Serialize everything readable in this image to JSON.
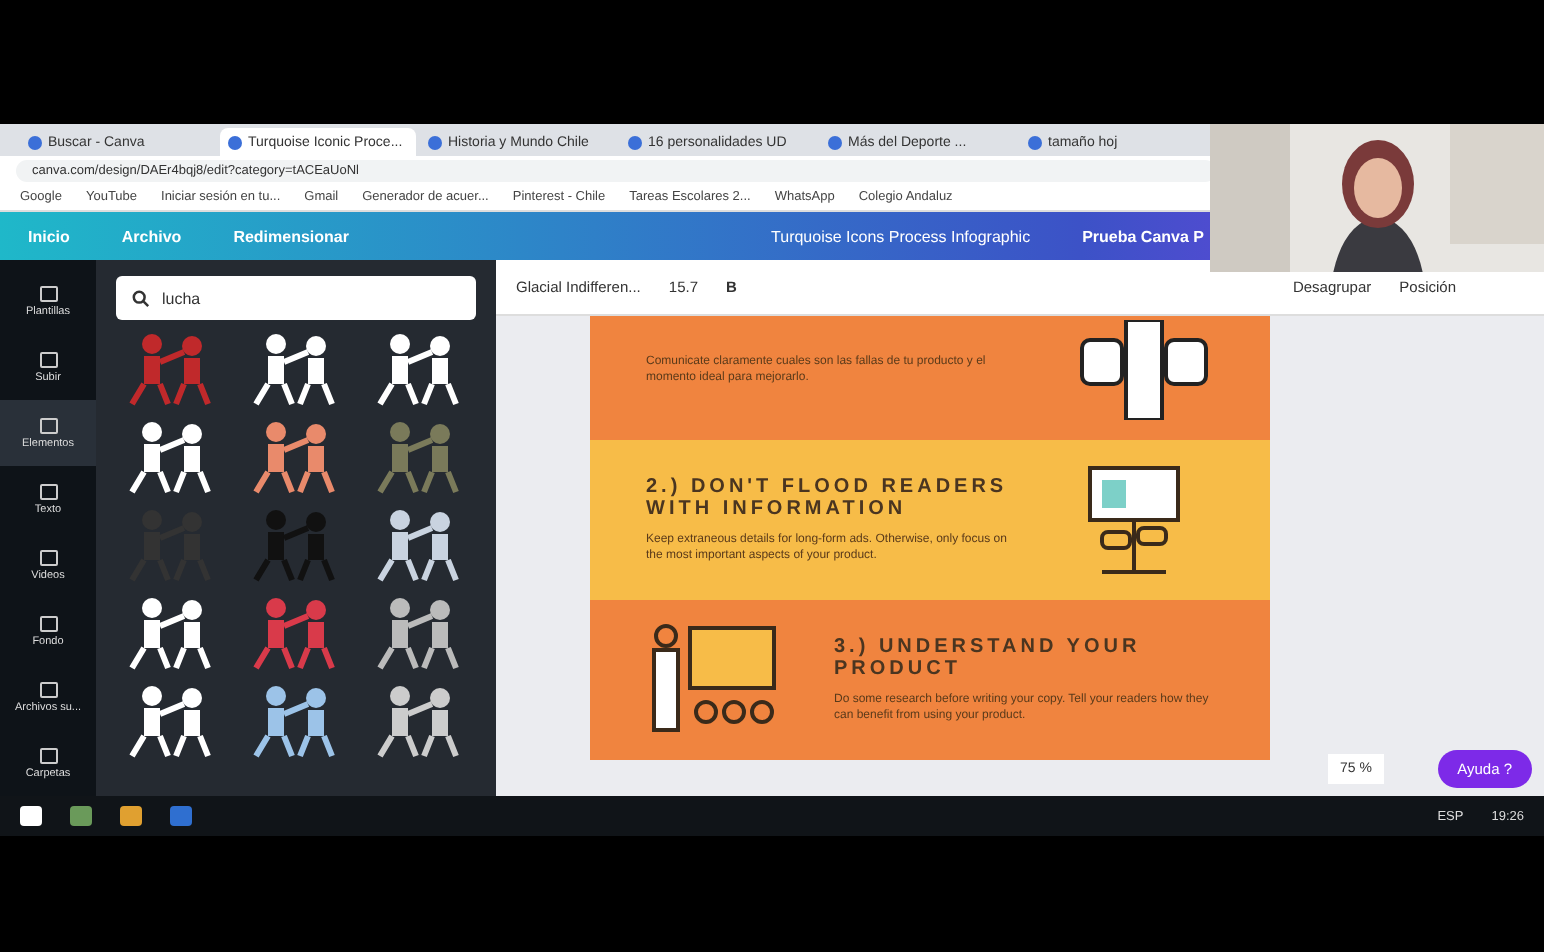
{
  "browser": {
    "tabs": [
      {
        "title": "Buscar - Canva",
        "selected": false
      },
      {
        "title": "Turquoise Iconic Proce...",
        "selected": true
      },
      {
        "title": "Historia y Mundo Chile",
        "selected": false
      },
      {
        "title": "16 personalidades UD",
        "selected": false
      },
      {
        "title": "Más del Deporte ...",
        "selected": false
      },
      {
        "title": "tamaño hoj",
        "selected": false
      }
    ],
    "url": "canva.com/design/DAEr4bqj8/edit?category=tACEaUoNl",
    "bookmarks": [
      "Google",
      "YouTube",
      "Iniciar sesión en tu...",
      "Gmail",
      "Generador de acuer...",
      "Pinterest - Chile",
      "Tareas Escolares 2...",
      "WhatsApp",
      "Colegio Andaluz"
    ]
  },
  "editor": {
    "menu": [
      "Inicio",
      "Archivo",
      "Redimensionar"
    ],
    "design_title": "Turquoise Icons Process Infographic",
    "upgrade": "Prueba Canva P",
    "rail": [
      {
        "label": "Plantillas",
        "selected": false
      },
      {
        "label": "Subir",
        "selected": false
      },
      {
        "label": "Elementos",
        "selected": true
      },
      {
        "label": "Texto",
        "selected": false
      },
      {
        "label": "Videos",
        "selected": false
      },
      {
        "label": "Fondo",
        "selected": false
      },
      {
        "label": "Archivos su...",
        "selected": false
      },
      {
        "label": "Carpetas",
        "selected": false
      }
    ],
    "search": {
      "value": "lucha"
    },
    "toolbar": {
      "font": "Glacial Indifferen...",
      "size": "15.7",
      "bold": "B",
      "actions": [
        "Desagrupar",
        "Posición"
      ]
    },
    "sections": [
      {
        "body": "Comunicate claramente cuales son las fallas de tu producto y el momento ideal para mejorarlo.",
        "color": "#f0843f"
      },
      {
        "heading": "2.) DON'T FLOOD READERS WITH INFORMATION",
        "body": "Keep extraneous details for long-form ads. Otherwise, only focus on the most important aspects of your product.",
        "color": "#f7bc48"
      },
      {
        "heading": "3.) UNDERSTAND YOUR PRODUCT",
        "body": "Do some research before writing your copy. Tell your readers how they can benefit from using your product.",
        "color": "#f0843f"
      }
    ],
    "zoom": "75 %",
    "help": "Ayuda ?"
  },
  "taskbar": {
    "language": "ESP",
    "time": "19:26"
  }
}
